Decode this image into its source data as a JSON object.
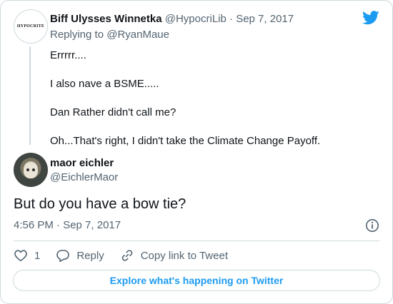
{
  "parent_tweet": {
    "avatar_text": "HYPOCRITE",
    "name": "Biff Ulysses Winnetka",
    "handle": "@HypocriLib",
    "separator": "·",
    "date": "Sep 7, 2017",
    "replying_prefix": "Replying to",
    "replying_to": "@RyanMaue",
    "lines": [
      "Errrrr....",
      "I also nave a BSME.....",
      "Dan Rather didn't call me?",
      "Oh...That's right, I didn't take the Climate Change Payoff."
    ]
  },
  "main_tweet": {
    "name": "maor eichler",
    "handle": "@EichlerMaor",
    "text": "But do you have a bow tie?",
    "timestamp": "4:56 PM · Sep 7, 2017"
  },
  "actions": {
    "like_count": "1",
    "reply_label": "Reply",
    "copy_link_label": "Copy link to Tweet"
  },
  "explore_label": "Explore what's happening on Twitter",
  "colors": {
    "accent": "#1d9bf0",
    "muted_text": "#536471",
    "border": "#cfd9de"
  }
}
